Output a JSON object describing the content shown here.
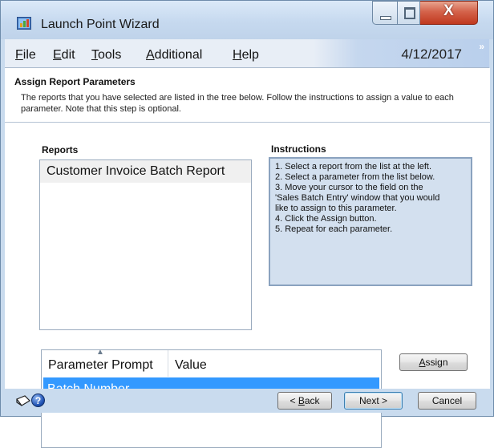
{
  "window": {
    "title": "Launch Point Wizard",
    "close_glyph": "X"
  },
  "menu": {
    "items": [
      {
        "label": "File",
        "mnemonic": "F",
        "rest": "ile"
      },
      {
        "label": "Edit",
        "mnemonic": "E",
        "rest": "dit"
      },
      {
        "label": "Tools",
        "mnemonic": "T",
        "rest": "ools"
      },
      {
        "label": "Additional",
        "mnemonic": "A",
        "rest": "dditional"
      },
      {
        "label": "Help",
        "mnemonic": "H",
        "rest": "elp"
      }
    ],
    "date": "4/12/2017",
    "overflow_glyph": "»"
  },
  "header": {
    "title": "Assign Report Parameters",
    "text": "The reports that you have selected are listed in the tree below.  Follow the instructions to assign a value to each parameter.  Note that this step is optional."
  },
  "reports": {
    "label": "Reports",
    "items": [
      "Customer Invoice Batch Report"
    ]
  },
  "instructions": {
    "label": "Instructions",
    "lines": [
      "1. Select a report from the list at the left.",
      "2. Select a parameter from the list below.",
      "3. Move your cursor to the field on the",
      "'Sales Batch Entry' window that you would",
      "like to assign to this parameter.",
      "4. Click the Assign button.",
      "5. Repeat for each parameter."
    ]
  },
  "parameters": {
    "columns": [
      "Parameter Prompt",
      "Value"
    ],
    "rows": [
      {
        "prompt": "Batch Number",
        "value": ""
      }
    ]
  },
  "buttons": {
    "assign": "Assign",
    "back": "< Back",
    "next": "Next >",
    "cancel": "Cancel"
  },
  "footer": {
    "help_glyph": "?"
  },
  "icons": {
    "app": "launch-point-wizard-icon",
    "minimize": "minimize-icon",
    "maximize": "maximize-icon",
    "close": "close-icon",
    "note": "note-icon",
    "help": "help-icon"
  },
  "colors": {
    "selection": "#3399ff",
    "window_frame": "#c9dbee",
    "close_button": "#c0391f"
  }
}
